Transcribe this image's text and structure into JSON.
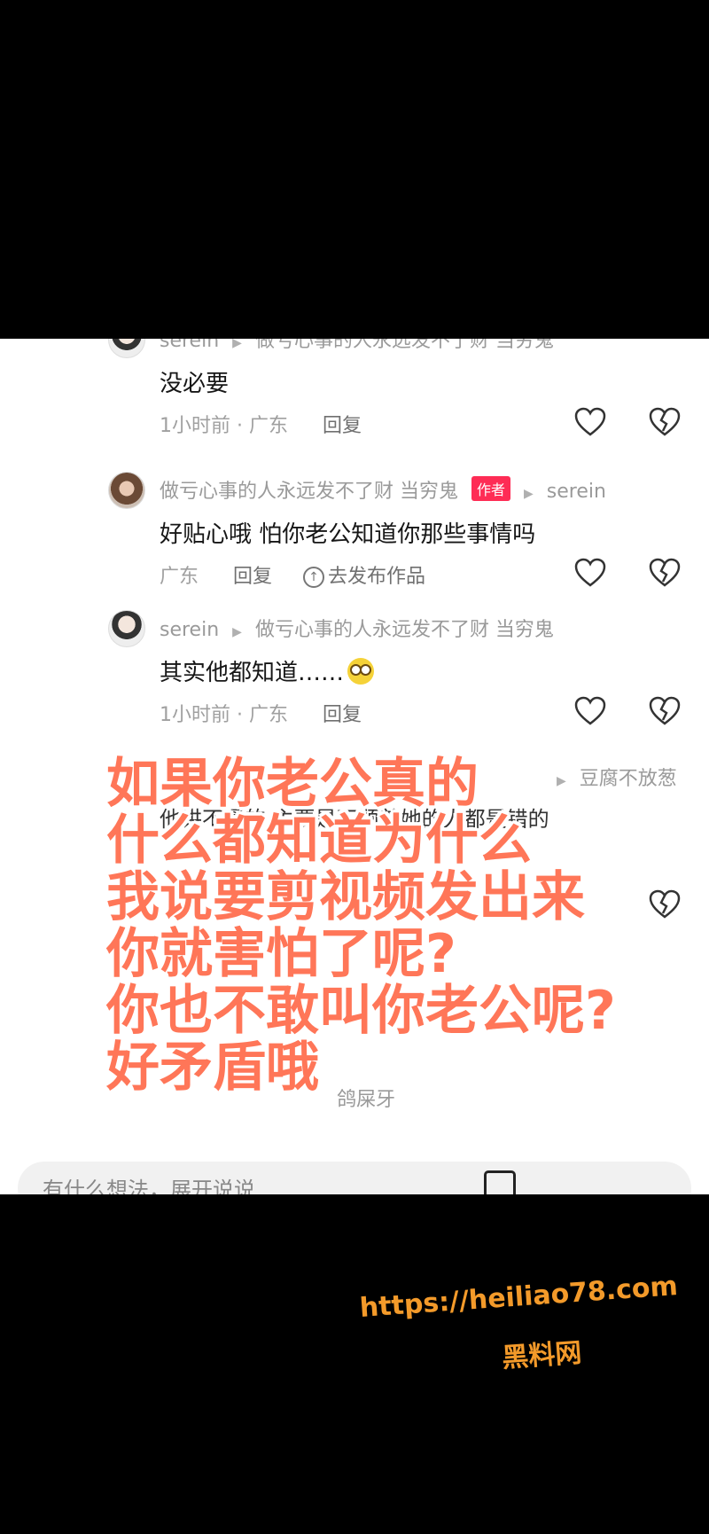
{
  "comments": [
    {
      "user": "serein",
      "reply_to": "做亏心事的人永远发不了财 当穷鬼",
      "text": "没必要",
      "time": "1小时前 · 广东",
      "reply": "回复"
    },
    {
      "user": "做亏心事的人永远发不了财 当穷鬼",
      "badge": "作者",
      "reply_to": "serein",
      "text": "好贴心哦 怕你老公知道你那些事情吗",
      "location": "广东",
      "reply": "回复",
      "publish": "去发布作品"
    },
    {
      "user": "serein",
      "reply_to": "做亏心事的人永远发不了财 当穷鬼",
      "text": "其实他都知道……",
      "time": "1小时前 · 广东",
      "reply": "回复"
    }
  ],
  "partial_comments": {
    "reply_to_4": "豆腐不放葱",
    "text_4": "他讲不通的 主要是不顺着她的人都是错的",
    "user_6": "鸽屎牙"
  },
  "overlay_lines": [
    "如果你老公真的",
    "什么都知道为什么",
    "我说要剪视频发出来",
    "你就害怕了呢?",
    "你也不敢叫你老公呢?",
    "好矛盾哦"
  ],
  "input_bar": {
    "placeholder": "有什么想法，展开说说"
  },
  "watermark": {
    "url": "https://heiliao78.com",
    "name": "黑料网"
  },
  "colors": {
    "overlay_text": "#ff7658",
    "author_badge": "#fe2c55",
    "watermark": "#f39a2a"
  },
  "icons": {
    "like": "heart-icon",
    "dislike": "broken-heart-icon",
    "picture": "image-icon"
  }
}
